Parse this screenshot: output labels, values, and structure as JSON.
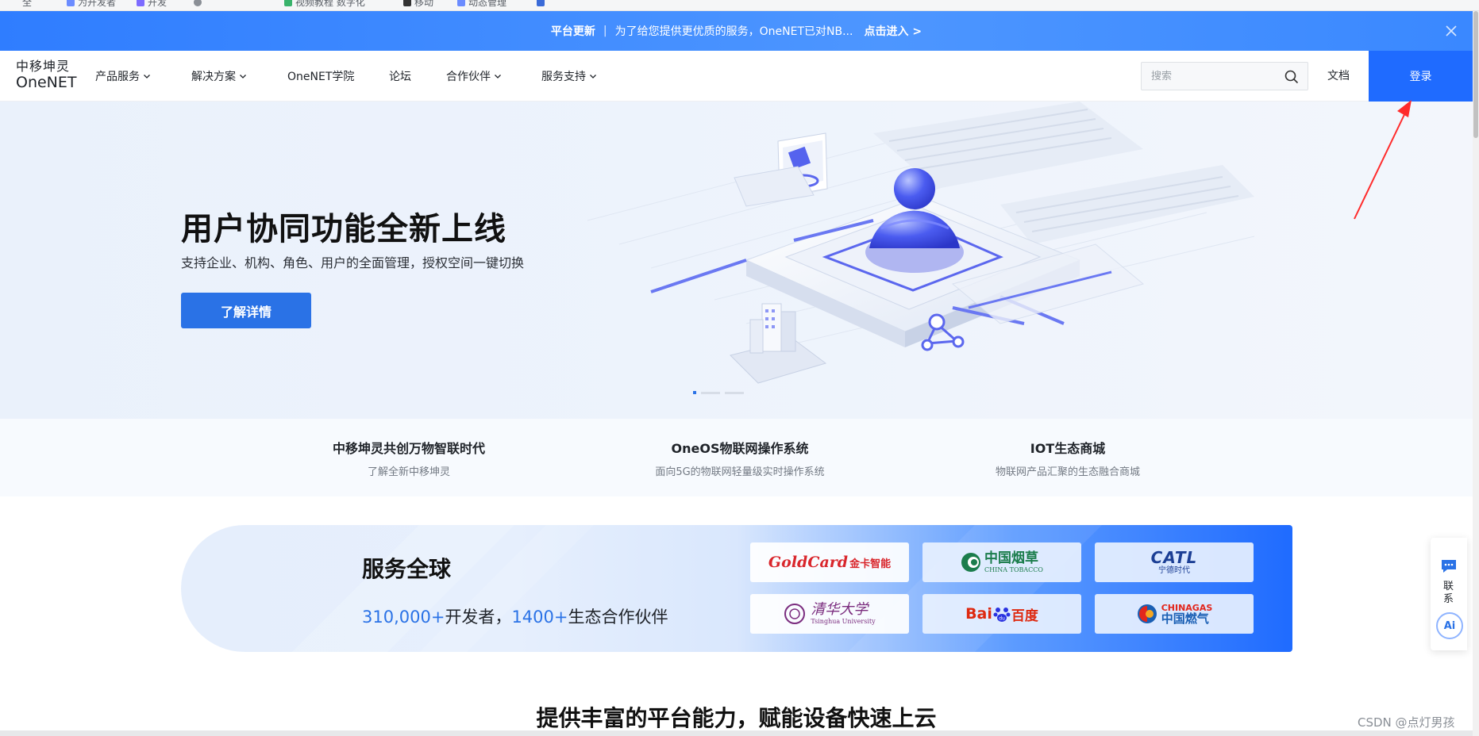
{
  "bookmarks": [
    "全",
    "为开发者",
    "开发",
    "",
    "视频教程 数字化",
    "移动",
    "动态管理",
    ""
  ],
  "announcement": {
    "tag": "平台更新",
    "message": "为了给您提供更优质的服务，OneNET已对NB...",
    "link": "点击进入 >"
  },
  "header": {
    "logo_cn": "中移坤灵",
    "logo_en": "OneNET",
    "nav": [
      "产品服务",
      "解决方案",
      "OneNET学院",
      "论坛",
      "合作伙伴",
      "服务支持"
    ],
    "search_placeholder": "搜索",
    "docs": "文档",
    "login": "登录"
  },
  "hero": {
    "title": "用户协同功能全新上线",
    "subtitle": "支持企业、机构、角色、用户的全面管理，授权空间一键切换",
    "button": "了解详情",
    "active_slide": 1,
    "slide_count": 3
  },
  "quick_links": [
    {
      "title": "中移坤灵共创万物智联时代",
      "subtitle": "了解全新中移坤灵"
    },
    {
      "title": "OneOS物联网操作系统",
      "subtitle": "面向5G的物联网轻量级实时操作系统"
    },
    {
      "title": "IOT生态商城",
      "subtitle": "物联网产品汇聚的生态融合商城"
    }
  ],
  "global": {
    "title": "服务全球",
    "dev_count": "310,000+",
    "dev_label": "开发者，",
    "partner_count": "1400+",
    "partner_label": "生态合作伙伴"
  },
  "partners": {
    "goldcard_a": "GoldCard",
    "goldcard_b": "金卡智能",
    "tobacco_cn": "中国烟草",
    "tobacco_en": "CHINA TOBACCO",
    "catl_en": "CATL",
    "catl_cn": "宁德时代",
    "tsinghua_cn": "清华大学",
    "tsinghua_en": "Tsinghua University",
    "baidu_a": "Bai",
    "baidu_b": "du",
    "baidu_cn": "百度",
    "gas_en": "CHINAGAS",
    "gas_cn": "中国燃气"
  },
  "section_title": "提供丰富的平台能力，赋能设备快速上云",
  "float": {
    "contact": "联系",
    "ai": "Ai"
  },
  "watermark": "CSDN @点灯男孩",
  "colors": {
    "primary": "#1f6bff",
    "hero_button": "#2a72e6",
    "annotation_arrow": "#ff2b2b"
  }
}
